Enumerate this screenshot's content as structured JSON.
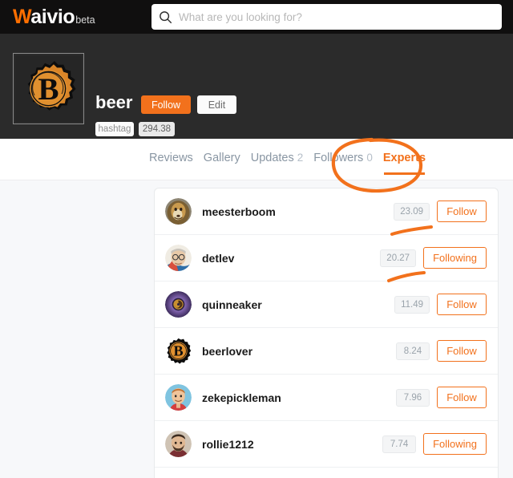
{
  "brand": {
    "name_accent": "W",
    "name_rest": "aivio",
    "suffix": "beta"
  },
  "search": {
    "placeholder": "What are you looking for?",
    "value": "",
    "icon": "search-icon"
  },
  "profile": {
    "name": "beer",
    "follow_label": "Follow",
    "edit_label": "Edit",
    "tag_label": "hashtag",
    "rating_value": "294.38",
    "avatar_icon": "bottle-cap-b-icon"
  },
  "tabs": [
    {
      "label": "Reviews",
      "count": "",
      "active": false
    },
    {
      "label": "Gallery",
      "count": "",
      "active": false
    },
    {
      "label": "Updates",
      "count": "2",
      "active": false
    },
    {
      "label": "Followers",
      "count": "0",
      "active": false
    },
    {
      "label": "Experts",
      "count": "",
      "active": true
    }
  ],
  "experts": [
    {
      "username": "meesterboom",
      "score": "23.09",
      "action": "Follow",
      "following": false,
      "avatar": "lion-avatar"
    },
    {
      "username": "detlev",
      "score": "20.27",
      "action": "Following",
      "following": true,
      "avatar": "man-glasses-avatar"
    },
    {
      "username": "quinneaker",
      "score": "11.49",
      "action": "Follow",
      "following": false,
      "avatar": "purple-spiral-avatar"
    },
    {
      "username": "beerlover",
      "score": "8.24",
      "action": "Follow",
      "following": false,
      "avatar": "bottle-cap-b-avatar"
    },
    {
      "username": "zekepickleman",
      "score": "7.96",
      "action": "Follow",
      "following": false,
      "avatar": "cartoon-man-avatar"
    },
    {
      "username": "rollie1212",
      "score": "7.74",
      "action": "Following",
      "following": true,
      "avatar": "bearded-man-avatar"
    }
  ],
  "annotations": {
    "circle_target": "Experts",
    "underline_1_target": "meesterboom-row",
    "underline_2_target": "detlev-row",
    "ink_color": "#f2711c"
  },
  "colors": {
    "accent": "#f2711c",
    "topbar_bg": "#100f0f",
    "profile_bg": "#2b2b2b",
    "page_bg": "#f7f8fa",
    "card_bg": "#ffffff",
    "tab_inactive": "#8996a3"
  }
}
